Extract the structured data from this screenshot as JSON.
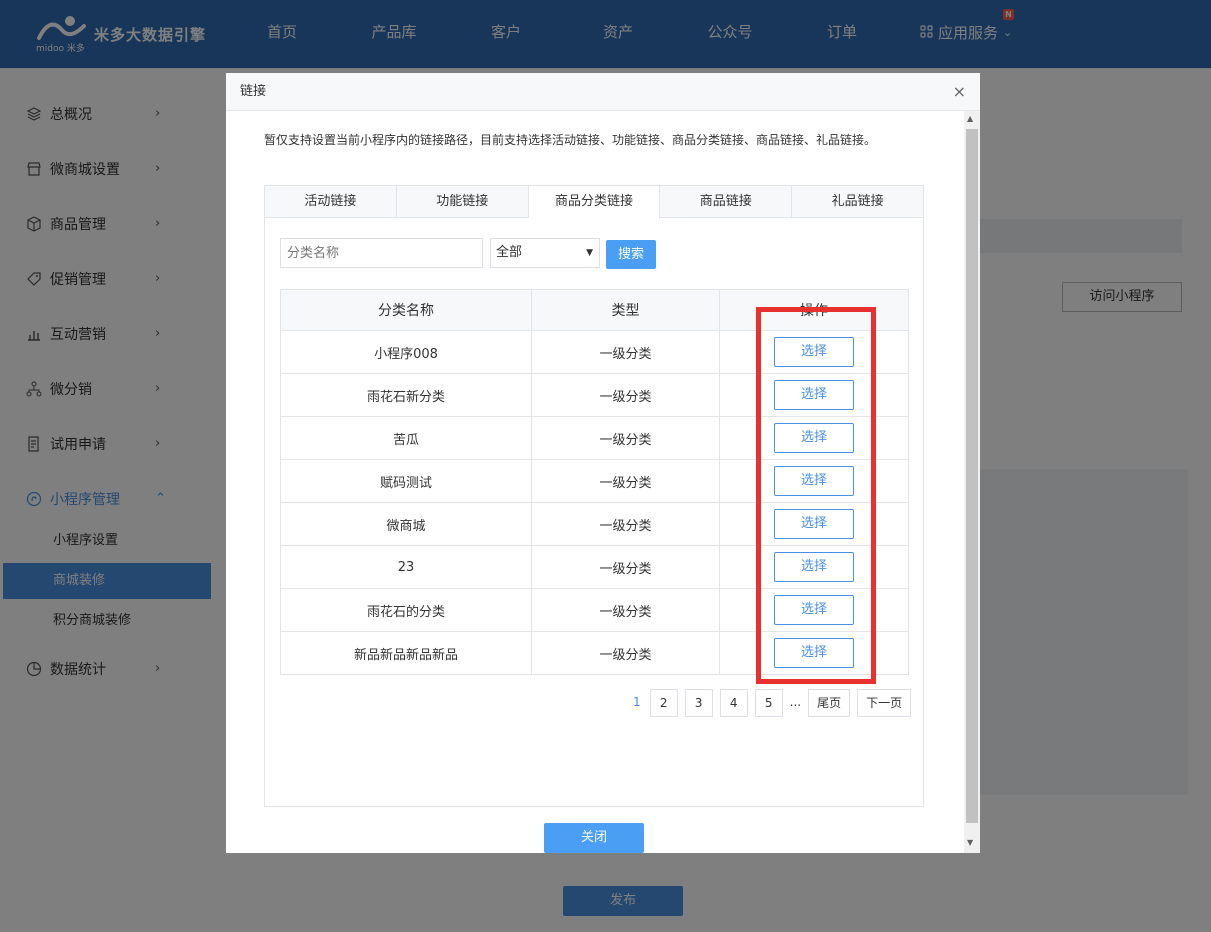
{
  "brand": {
    "name": "米多大数据引擎",
    "sub": "midoo 米多"
  },
  "nav": {
    "items": [
      "首页",
      "产品库",
      "客户",
      "资产",
      "公众号",
      "订单"
    ],
    "apps_label": "应用服务",
    "badge": "N"
  },
  "sidebar": {
    "items": [
      {
        "label": "总概况",
        "icon": "layers-icon"
      },
      {
        "label": "微商城设置",
        "icon": "store-icon"
      },
      {
        "label": "商品管理",
        "icon": "box-icon"
      },
      {
        "label": "促销管理",
        "icon": "tag-icon"
      },
      {
        "label": "互动营销",
        "icon": "bar-chart-icon"
      },
      {
        "label": "微分销",
        "icon": "network-icon"
      },
      {
        "label": "试用申请",
        "icon": "form-icon"
      },
      {
        "label": "小程序管理",
        "icon": "miniprogram-icon"
      },
      {
        "label": "数据统计",
        "icon": "pie-chart-icon"
      }
    ],
    "subitems": [
      "小程序设置",
      "商城装修",
      "积分商城装修"
    ],
    "active_sub": "商城装修"
  },
  "background": {
    "visit_button": "访问小程序",
    "publish_button": "发布"
  },
  "modal": {
    "title": "链接",
    "close_symbol": "×",
    "notice": "暂仅支持设置当前小程序内的链接路径，目前支持选择活动链接、功能链接、商品分类链接、商品链接、礼品链接。",
    "tabs": [
      "活动链接",
      "功能链接",
      "商品分类链接",
      "商品链接",
      "礼品链接"
    ],
    "active_tab": "商品分类链接",
    "search": {
      "placeholder": "分类名称",
      "select_value": "全部",
      "button": "搜索"
    },
    "table": {
      "headers": [
        "分类名称",
        "类型",
        "操作"
      ],
      "rows": [
        {
          "name": "小程序008",
          "type": "一级分类",
          "action": "选择"
        },
        {
          "name": "雨花石新分类",
          "type": "一级分类",
          "action": "选择"
        },
        {
          "name": "苦瓜",
          "type": "一级分类",
          "action": "选择"
        },
        {
          "name": "赋码测试",
          "type": "一级分类",
          "action": "选择"
        },
        {
          "name": "微商城",
          "type": "一级分类",
          "action": "选择"
        },
        {
          "name": "23",
          "type": "一级分类",
          "action": "选择"
        },
        {
          "name": "雨花石的分类",
          "type": "一级分类",
          "action": "选择"
        },
        {
          "name": "新品新品新品新品",
          "type": "一级分类",
          "action": "选择"
        }
      ]
    },
    "pager": {
      "current": "1",
      "pages": [
        "2",
        "3",
        "4",
        "5"
      ],
      "ellipsis": "...",
      "last": "尾页",
      "next": "下一页"
    },
    "close_button": "关闭"
  },
  "colors": {
    "nav_bg": "#2f6db3",
    "accent": "#4a90e2",
    "highlight": "#e8302f"
  }
}
